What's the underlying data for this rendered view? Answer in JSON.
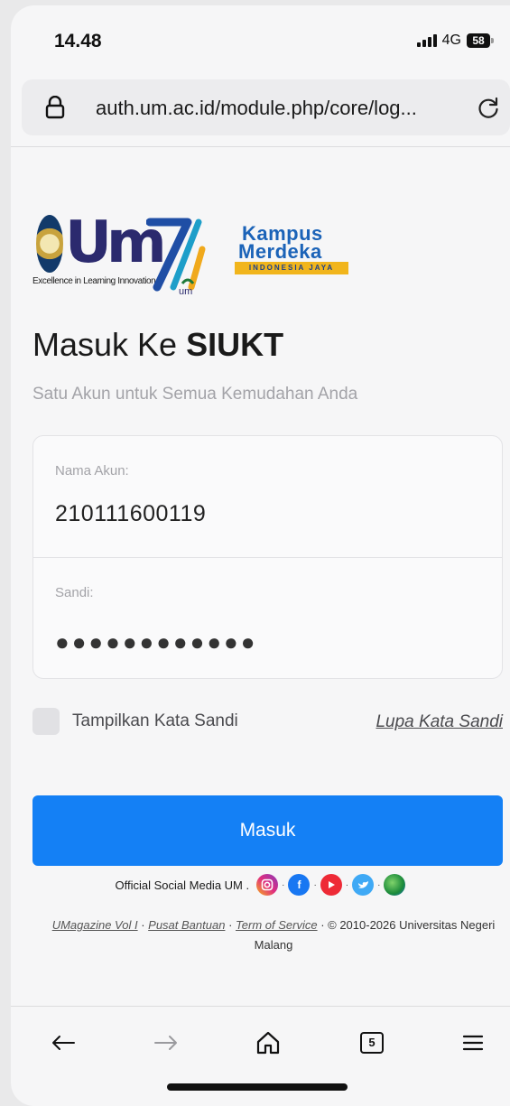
{
  "status_bar": {
    "time": "14.48",
    "network": "4G",
    "battery": "58"
  },
  "browser": {
    "url": "auth.um.ac.id/module.php/core/log..."
  },
  "logos": {
    "um_letters": "UM",
    "um_tagline": "Excellence in Learning Innovation",
    "seventy_caption": "um",
    "kampus_line1": "Kampus",
    "kampus_line2": "Merdeka",
    "kampus_band": "INDONESIA JAYA"
  },
  "login": {
    "title_prefix": "Masuk Ke ",
    "title_brand": "SIUKT",
    "subtitle": "Satu Akun untuk Semua Kemudahan Anda",
    "username_label": "Nama Akun:",
    "username_value": "210111600119",
    "password_label": "Sandi:",
    "password_mask": "●●●●●●●●●●●●",
    "show_password_label": "Tampilkan Kata Sandi",
    "forgot_link": "Lupa Kata Sandi",
    "submit_label": "Masuk"
  },
  "social": {
    "text": "Official Social Media UM .",
    "icons": [
      "instagram-icon",
      "facebook-icon",
      "youtube-icon",
      "twitter-icon",
      "website-icon"
    ]
  },
  "footer": {
    "link1": "UMagazine Vol I",
    "sep": " · ",
    "link2": "Pusat Bantuan",
    "link3": "Term of Service",
    "copyright": " · © 2010-2026 Universitas Negeri Malang"
  },
  "bottom_nav": {
    "tab_count": "5"
  },
  "colors": {
    "primary": "#1480f5",
    "um_navy": "#2b2a6e",
    "kampus_blue": "#1b63b8",
    "kampus_yellow": "#f1b51c"
  }
}
